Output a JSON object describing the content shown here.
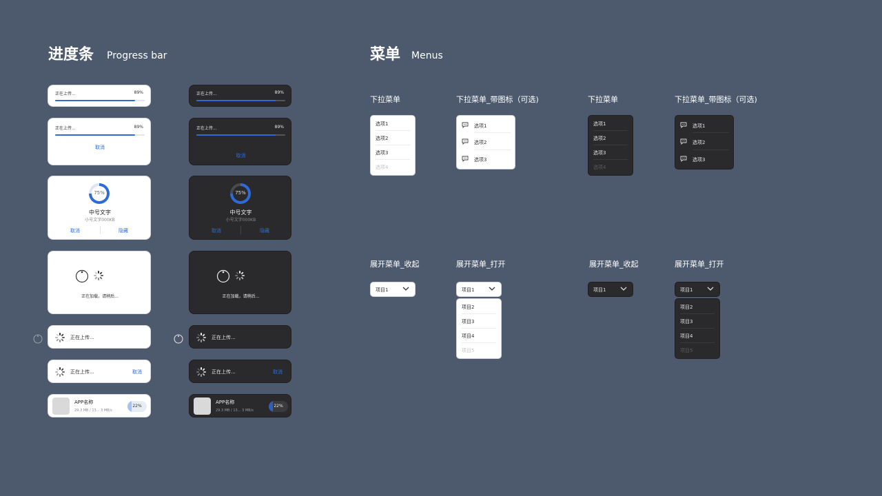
{
  "progress_section": {
    "title_zh": "进度条",
    "title_en": "Progress bar",
    "uploading": "正在上传...",
    "percent": "89%",
    "progress_fraction": 0.89,
    "cancel": "取消",
    "hide": "隐藏",
    "ring_percent": "75%",
    "ring_fraction": 0.75,
    "medium_text": "中号文字",
    "small_text": "小号文字000KB",
    "loading": "正在加载，请稍后...",
    "app_name": "APP名称",
    "app_stats": "29.3 MB / 13... 3 MB/s",
    "app_percent": "22%",
    "app_fraction": 0.22
  },
  "menus_section": {
    "title_zh": "菜单",
    "title_en": "Menus",
    "dropdown_title": "下拉菜单",
    "dropdown_icon_title": "下拉菜单_带图标（可选)",
    "options": [
      "选项1",
      "选项2",
      "选项3",
      "选项4"
    ],
    "icon_options": [
      "选项1",
      "选项2",
      "选项3"
    ],
    "collapsed_title": "展开菜单_收起",
    "open_title": "展开菜单_打开",
    "selected": "项目1",
    "items": [
      "项目2",
      "项目3",
      "项目4",
      "项目5"
    ]
  },
  "colors": {
    "background": "#4d5a6e",
    "accent": "#2f6bd8",
    "light_card": "#ffffff",
    "dark_card": "#2a2a2c"
  },
  "icons": [
    "spinner-icon",
    "chat-bubble-icon",
    "chevron-down-icon",
    "loading-circle-icon"
  ]
}
